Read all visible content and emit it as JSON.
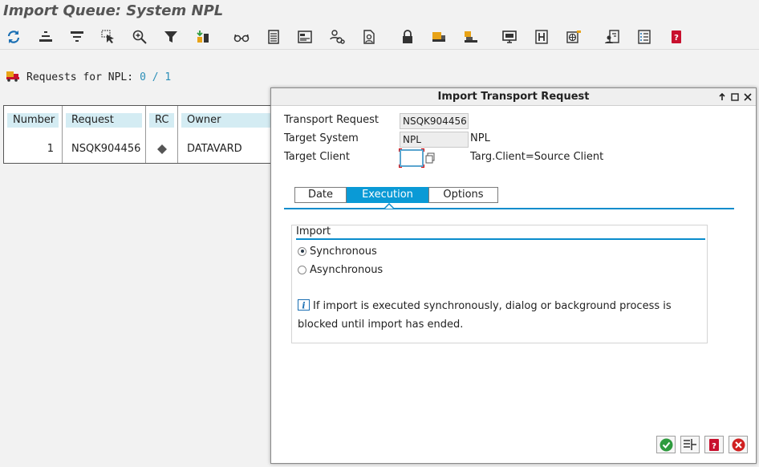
{
  "title": "Import Queue: System NPL",
  "toolbar": {
    "icons": [
      "refresh-icon",
      "expand-icon",
      "collapse-icon",
      "select-icon",
      "zoom-icon",
      "filter-icon",
      "import-icon",
      "glasses-icon",
      "list-icon",
      "layout-icon",
      "user-link-icon",
      "document-user-icon",
      "lock-icon",
      "truck-icon",
      "truck-all-icon",
      "monitor-icon",
      "history-icon",
      "network-icon",
      "user-settings-icon",
      "checklist-icon",
      "help-book-icon"
    ]
  },
  "requests": {
    "label": "Requests for NPL:",
    "count": "0 / 1"
  },
  "table": {
    "headers": [
      "Number",
      "Request",
      "RC",
      "Owner"
    ],
    "rows": [
      {
        "number": "1",
        "request": "NSQK904456",
        "rc": "diamond",
        "owner": "DATAVARD"
      }
    ]
  },
  "dialog": {
    "title": "Import Transport Request",
    "fields": {
      "transport_request_label": "Transport Request",
      "transport_request_value": "NSQK904456",
      "target_system_label": "Target System",
      "target_system_value": "NPL",
      "target_system_desc": "NPL",
      "target_client_label": "Target Client",
      "target_client_value": "",
      "target_client_note": "Targ.Client=Source Client"
    },
    "tabs": [
      {
        "label": "Date",
        "active": false
      },
      {
        "label": "Execution",
        "active": true
      },
      {
        "label": "Options",
        "active": false
      }
    ],
    "group": {
      "title": "Import",
      "options": [
        {
          "label": "Synchronous",
          "selected": true
        },
        {
          "label": "Asynchronous",
          "selected": false
        }
      ],
      "info_line1": "If import is executed synchronously, dialog or background process is",
      "info_line2": "blocked until import has ended."
    },
    "buttons": [
      "confirm-icon",
      "details-icon",
      "help-icon",
      "cancel-icon"
    ]
  },
  "colors": {
    "accent": "#0a9ad6",
    "header_cell": "#d4ecf3",
    "confirm": "#2e9b3e",
    "cancel": "#d02020"
  }
}
